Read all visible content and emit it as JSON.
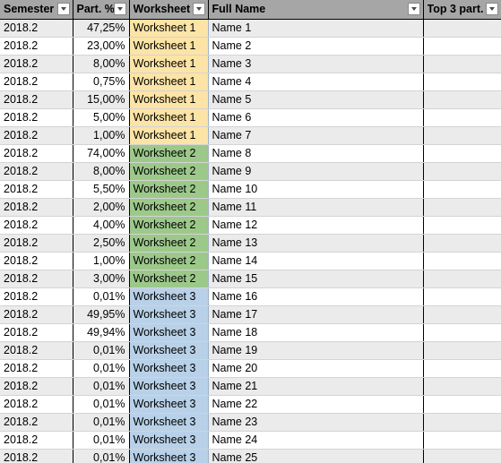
{
  "table": {
    "columns": [
      {
        "key": "semester",
        "label": "Semester",
        "filter": true,
        "align": "left"
      },
      {
        "key": "part",
        "label": "Part. %",
        "filter": true,
        "align": "right"
      },
      {
        "key": "worksheet",
        "label": "Worksheet",
        "filter": true,
        "align": "left"
      },
      {
        "key": "fullname",
        "label": "Full Name",
        "filter": true,
        "align": "left"
      },
      {
        "key": "top3",
        "label": "Top 3 part.",
        "filter": true,
        "align": "left"
      }
    ],
    "filter_icon": "chevron-down-icon",
    "header_background": "#a6a6a6",
    "band_colors": [
      "#ffffff",
      "#ebebeb"
    ],
    "worksheet_colors": {
      "Worksheet 1": "#fce4a6",
      "Worksheet 2": "#9cc98a",
      "Worksheet 3": "#b8d1e8"
    },
    "rows": [
      {
        "semester": "2018.2",
        "part": "47,25%",
        "worksheet": "Worksheet 1",
        "fullname": "Name 1",
        "top3": ""
      },
      {
        "semester": "2018.2",
        "part": "23,00%",
        "worksheet": "Worksheet 1",
        "fullname": "Name 2",
        "top3": ""
      },
      {
        "semester": "2018.2",
        "part": "8,00%",
        "worksheet": "Worksheet 1",
        "fullname": "Name 3",
        "top3": ""
      },
      {
        "semester": "2018.2",
        "part": "0,75%",
        "worksheet": "Worksheet 1",
        "fullname": "Name 4",
        "top3": ""
      },
      {
        "semester": "2018.2",
        "part": "15,00%",
        "worksheet": "Worksheet 1",
        "fullname": "Name 5",
        "top3": ""
      },
      {
        "semester": "2018.2",
        "part": "5,00%",
        "worksheet": "Worksheet 1",
        "fullname": "Name 6",
        "top3": ""
      },
      {
        "semester": "2018.2",
        "part": "1,00%",
        "worksheet": "Worksheet 1",
        "fullname": "Name 7",
        "top3": ""
      },
      {
        "semester": "2018.2",
        "part": "74,00%",
        "worksheet": "Worksheet 2",
        "fullname": "Name 8",
        "top3": ""
      },
      {
        "semester": "2018.2",
        "part": "8,00%",
        "worksheet": "Worksheet 2",
        "fullname": "Name 9",
        "top3": ""
      },
      {
        "semester": "2018.2",
        "part": "5,50%",
        "worksheet": "Worksheet 2",
        "fullname": "Name 10",
        "top3": ""
      },
      {
        "semester": "2018.2",
        "part": "2,00%",
        "worksheet": "Worksheet 2",
        "fullname": "Name 11",
        "top3": ""
      },
      {
        "semester": "2018.2",
        "part": "4,00%",
        "worksheet": "Worksheet 2",
        "fullname": "Name 12",
        "top3": ""
      },
      {
        "semester": "2018.2",
        "part": "2,50%",
        "worksheet": "Worksheet 2",
        "fullname": "Name 13",
        "top3": ""
      },
      {
        "semester": "2018.2",
        "part": "1,00%",
        "worksheet": "Worksheet 2",
        "fullname": "Name 14",
        "top3": ""
      },
      {
        "semester": "2018.2",
        "part": "3,00%",
        "worksheet": "Worksheet 2",
        "fullname": "Name 15",
        "top3": ""
      },
      {
        "semester": "2018.2",
        "part": "0,01%",
        "worksheet": "Worksheet 3",
        "fullname": "Name 16",
        "top3": ""
      },
      {
        "semester": "2018.2",
        "part": "49,95%",
        "worksheet": "Worksheet 3",
        "fullname": "Name 17",
        "top3": ""
      },
      {
        "semester": "2018.2",
        "part": "49,94%",
        "worksheet": "Worksheet 3",
        "fullname": "Name 18",
        "top3": ""
      },
      {
        "semester": "2018.2",
        "part": "0,01%",
        "worksheet": "Worksheet 3",
        "fullname": "Name 19",
        "top3": ""
      },
      {
        "semester": "2018.2",
        "part": "0,01%",
        "worksheet": "Worksheet 3",
        "fullname": "Name 20",
        "top3": ""
      },
      {
        "semester": "2018.2",
        "part": "0,01%",
        "worksheet": "Worksheet 3",
        "fullname": "Name 21",
        "top3": ""
      },
      {
        "semester": "2018.2",
        "part": "0,01%",
        "worksheet": "Worksheet 3",
        "fullname": "Name 22",
        "top3": ""
      },
      {
        "semester": "2018.2",
        "part": "0,01%",
        "worksheet": "Worksheet 3",
        "fullname": "Name 23",
        "top3": ""
      },
      {
        "semester": "2018.2",
        "part": "0,01%",
        "worksheet": "Worksheet 3",
        "fullname": "Name 24",
        "top3": ""
      },
      {
        "semester": "2018.2",
        "part": "0,01%",
        "worksheet": "Worksheet 3",
        "fullname": "Name 25",
        "top3": ""
      }
    ]
  }
}
